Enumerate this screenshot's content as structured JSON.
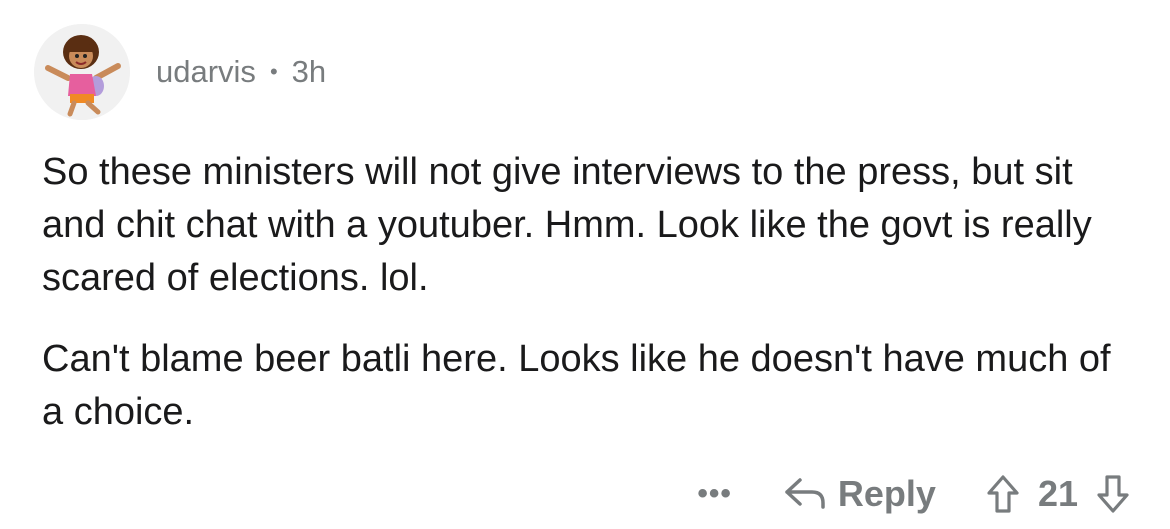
{
  "comment": {
    "author": "udarvis",
    "separator": "•",
    "age": "3h",
    "paragraphs": [
      "So these ministers will not give interviews to the press, but sit and chit chat with a youtuber. Hmm. Look like the govt is really scared of elections. lol.",
      "Can't blame beer batli here. Looks like he doesn't have much of a choice."
    ],
    "actions": {
      "more_label": "•••",
      "reply_label": "Reply",
      "score": "21"
    }
  },
  "icons": {
    "avatar": "cartoon-girl-avatar",
    "reply": "reply-arrow-icon",
    "upvote": "upvote-arrow-icon",
    "downvote": "downvote-arrow-icon"
  },
  "colors": {
    "text": "#1a1a1b",
    "meta": "#787c7e",
    "avatar_bg": "#f1f1f1"
  }
}
